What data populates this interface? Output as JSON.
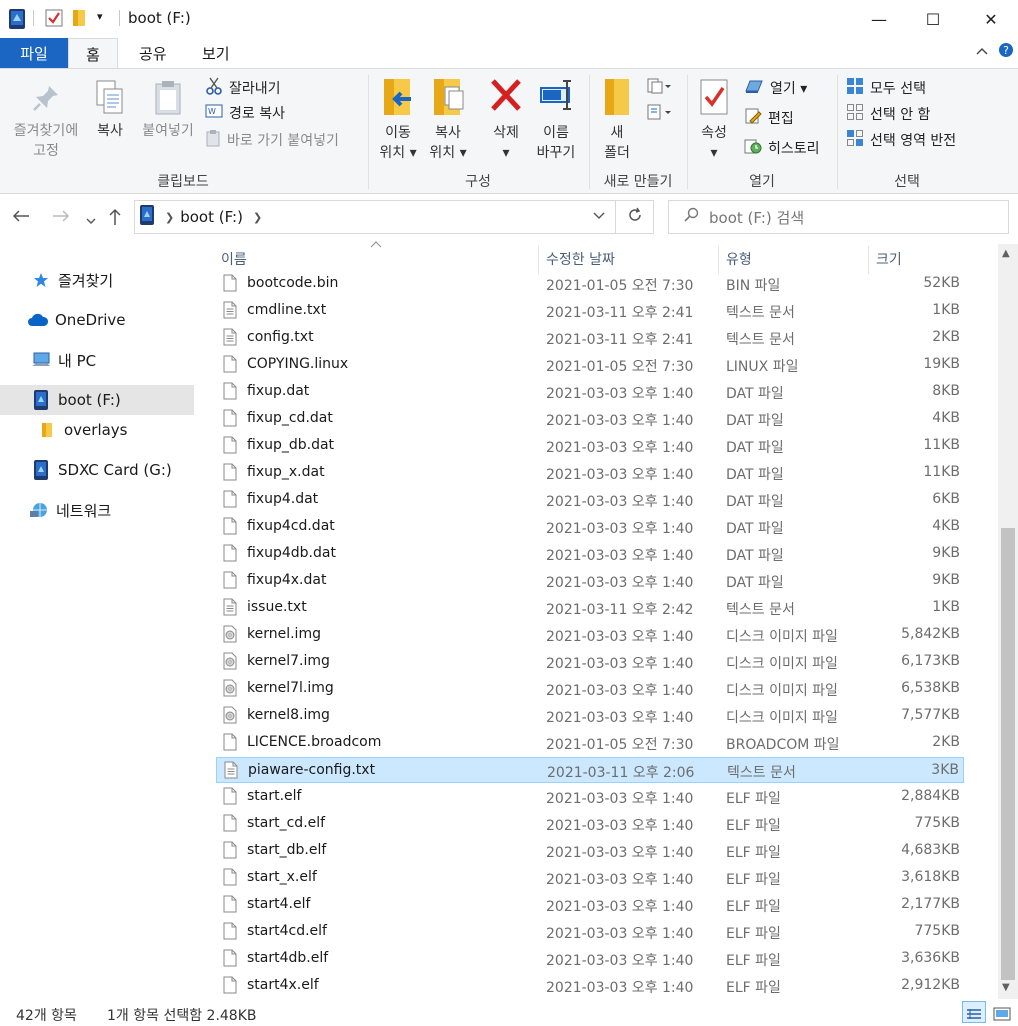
{
  "window": {
    "title": "boot (F:)",
    "controls": {
      "minimize": "—",
      "maximize": "☐",
      "close": "✕"
    }
  },
  "tabs": {
    "file": "파일",
    "home": "홈",
    "share": "공유",
    "view": "보기"
  },
  "ribbon": {
    "clipboard": {
      "label": "클립보드",
      "pin": "즐겨찾기에\n고정",
      "copy": "복사",
      "paste": "붙여넣기",
      "cut": "잘라내기",
      "copy_path": "경로 복사",
      "paste_shortcut": "바로 가기 붙여넣기"
    },
    "organize": {
      "label": "구성",
      "move_to": "이동\n위치 ▾",
      "copy_to": "복사\n위치 ▾",
      "delete": "삭제\n▾",
      "rename": "이름\n바꾸기"
    },
    "new": {
      "label": "새로 만들기",
      "new_folder": "새\n폴더"
    },
    "open": {
      "label": "열기",
      "properties": "속성\n▾",
      "open": "열기 ▾",
      "edit": "편집",
      "history": "히스토리"
    },
    "select": {
      "label": "선택",
      "select_all": "모두 선택",
      "select_none": "선택 안 함",
      "invert": "선택 영역 반전"
    }
  },
  "address": {
    "crumb": "boot (F:)",
    "search_placeholder": "boot (F:) 검색"
  },
  "nav_pane": [
    {
      "label": "즐겨찾기",
      "icon": "star-icon"
    },
    {
      "label": "OneDrive",
      "icon": "cloud-icon"
    },
    {
      "label": "내 PC",
      "icon": "pc-icon"
    },
    {
      "label": "boot (F:)",
      "icon": "drive-icon",
      "selected": true
    },
    {
      "label": "overlays",
      "icon": "folder-icon"
    },
    {
      "label": "SDXC Card (G:)",
      "icon": "drive-icon"
    },
    {
      "label": "네트워크",
      "icon": "network-icon"
    }
  ],
  "columns": {
    "name": "이름",
    "date": "수정한 날짜",
    "type": "유형",
    "size": "크기"
  },
  "files": [
    {
      "name": "bootcode.bin",
      "date": "2021-01-05 오전 7:30",
      "type": "BIN 파일",
      "size": "52KB",
      "icon": "file-icon"
    },
    {
      "name": "cmdline.txt",
      "date": "2021-03-11 오후 2:41",
      "type": "텍스트 문서",
      "size": "1KB",
      "icon": "text-file-icon"
    },
    {
      "name": "config.txt",
      "date": "2021-03-11 오후 2:41",
      "type": "텍스트 문서",
      "size": "2KB",
      "icon": "text-file-icon"
    },
    {
      "name": "COPYING.linux",
      "date": "2021-01-05 오전 7:30",
      "type": "LINUX 파일",
      "size": "19KB",
      "icon": "file-icon"
    },
    {
      "name": "fixup.dat",
      "date": "2021-03-03 오후 1:40",
      "type": "DAT 파일",
      "size": "8KB",
      "icon": "file-icon"
    },
    {
      "name": "fixup_cd.dat",
      "date": "2021-03-03 오후 1:40",
      "type": "DAT 파일",
      "size": "4KB",
      "icon": "file-icon"
    },
    {
      "name": "fixup_db.dat",
      "date": "2021-03-03 오후 1:40",
      "type": "DAT 파일",
      "size": "11KB",
      "icon": "file-icon"
    },
    {
      "name": "fixup_x.dat",
      "date": "2021-03-03 오후 1:40",
      "type": "DAT 파일",
      "size": "11KB",
      "icon": "file-icon"
    },
    {
      "name": "fixup4.dat",
      "date": "2021-03-03 오후 1:40",
      "type": "DAT 파일",
      "size": "6KB",
      "icon": "file-icon"
    },
    {
      "name": "fixup4cd.dat",
      "date": "2021-03-03 오후 1:40",
      "type": "DAT 파일",
      "size": "4KB",
      "icon": "file-icon"
    },
    {
      "name": "fixup4db.dat",
      "date": "2021-03-03 오후 1:40",
      "type": "DAT 파일",
      "size": "9KB",
      "icon": "file-icon"
    },
    {
      "name": "fixup4x.dat",
      "date": "2021-03-03 오후 1:40",
      "type": "DAT 파일",
      "size": "9KB",
      "icon": "file-icon"
    },
    {
      "name": "issue.txt",
      "date": "2021-03-11 오후 2:42",
      "type": "텍스트 문서",
      "size": "1KB",
      "icon": "text-file-icon"
    },
    {
      "name": "kernel.img",
      "date": "2021-03-03 오후 1:40",
      "type": "디스크 이미지 파일",
      "size": "5,842KB",
      "icon": "disc-image-icon"
    },
    {
      "name": "kernel7.img",
      "date": "2021-03-03 오후 1:40",
      "type": "디스크 이미지 파일",
      "size": "6,173KB",
      "icon": "disc-image-icon"
    },
    {
      "name": "kernel7l.img",
      "date": "2021-03-03 오후 1:40",
      "type": "디스크 이미지 파일",
      "size": "6,538KB",
      "icon": "disc-image-icon"
    },
    {
      "name": "kernel8.img",
      "date": "2021-03-03 오후 1:40",
      "type": "디스크 이미지 파일",
      "size": "7,577KB",
      "icon": "disc-image-icon"
    },
    {
      "name": "LICENCE.broadcom",
      "date": "2021-01-05 오전 7:30",
      "type": "BROADCOM 파일",
      "size": "2KB",
      "icon": "file-icon"
    },
    {
      "name": "piaware-config.txt",
      "date": "2021-03-11 오후 2:06",
      "type": "텍스트 문서",
      "size": "3KB",
      "icon": "text-file-icon",
      "selected": true
    },
    {
      "name": "start.elf",
      "date": "2021-03-03 오후 1:40",
      "type": "ELF 파일",
      "size": "2,884KB",
      "icon": "file-icon"
    },
    {
      "name": "start_cd.elf",
      "date": "2021-03-03 오후 1:40",
      "type": "ELF 파일",
      "size": "775KB",
      "icon": "file-icon"
    },
    {
      "name": "start_db.elf",
      "date": "2021-03-03 오후 1:40",
      "type": "ELF 파일",
      "size": "4,683KB",
      "icon": "file-icon"
    },
    {
      "name": "start_x.elf",
      "date": "2021-03-03 오후 1:40",
      "type": "ELF 파일",
      "size": "3,618KB",
      "icon": "file-icon"
    },
    {
      "name": "start4.elf",
      "date": "2021-03-03 오후 1:40",
      "type": "ELF 파일",
      "size": "2,177KB",
      "icon": "file-icon"
    },
    {
      "name": "start4cd.elf",
      "date": "2021-03-03 오후 1:40",
      "type": "ELF 파일",
      "size": "775KB",
      "icon": "file-icon"
    },
    {
      "name": "start4db.elf",
      "date": "2021-03-03 오후 1:40",
      "type": "ELF 파일",
      "size": "3,636KB",
      "icon": "file-icon"
    },
    {
      "name": "start4x.elf",
      "date": "2021-03-03 오후 1:40",
      "type": "ELF 파일",
      "size": "2,912KB",
      "icon": "file-icon"
    }
  ],
  "status": {
    "item_count": "42개 항목",
    "selection": "1개 항목 선택함 2.48KB"
  },
  "colors": {
    "file_tab": "#1a66c2",
    "selection_bg": "#cce8ff",
    "selection_border": "#99d1ff",
    "header_text": "#4c607a"
  }
}
